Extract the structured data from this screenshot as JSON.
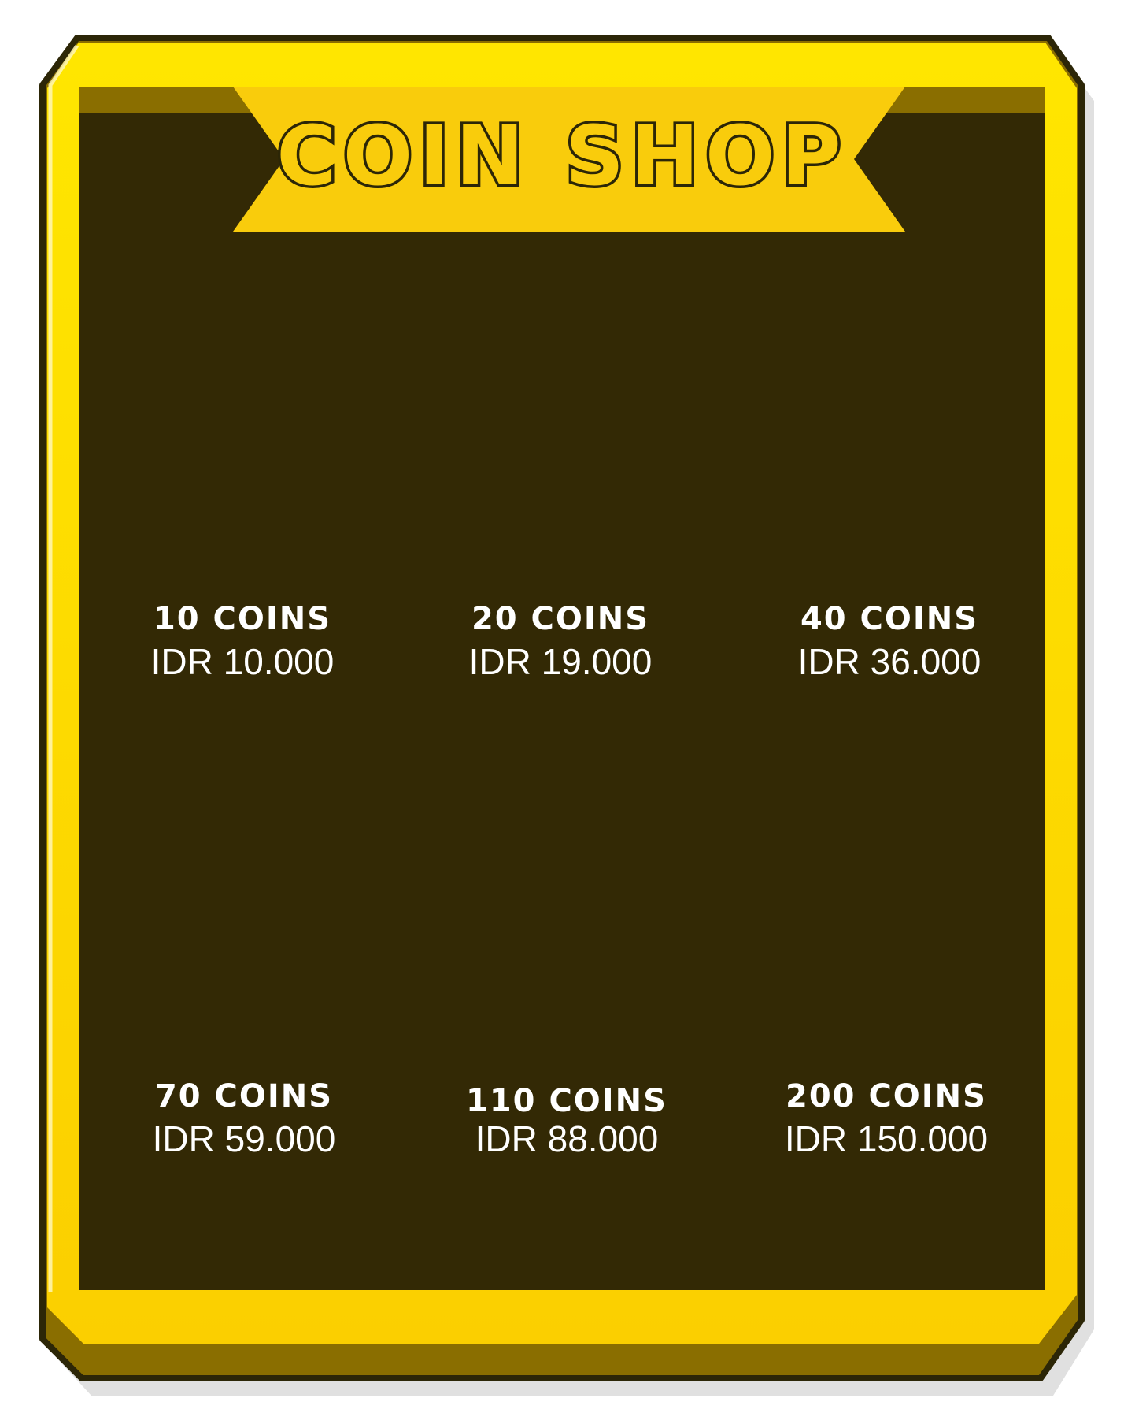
{
  "shop": {
    "title": "COIN SHOP",
    "offers": [
      {
        "coins": "10 COINS",
        "price": "IDR 10.000"
      },
      {
        "coins": "20 COINS",
        "price": "IDR 19.000"
      },
      {
        "coins": "40 COINS",
        "price": "IDR 36.000"
      },
      {
        "coins": "70 COINS",
        "price": "IDR 59.000"
      },
      {
        "coins": "110 COINS",
        "price": "IDR 88.000"
      },
      {
        "coins": "200 COINS",
        "price": "IDR 150.000"
      }
    ]
  },
  "colors": {
    "frame_yellow": "#fdd700",
    "frame_dark_gold": "#8a6e00",
    "outline": "#2c2607",
    "panel": "#332905",
    "text": "#ffffff"
  }
}
